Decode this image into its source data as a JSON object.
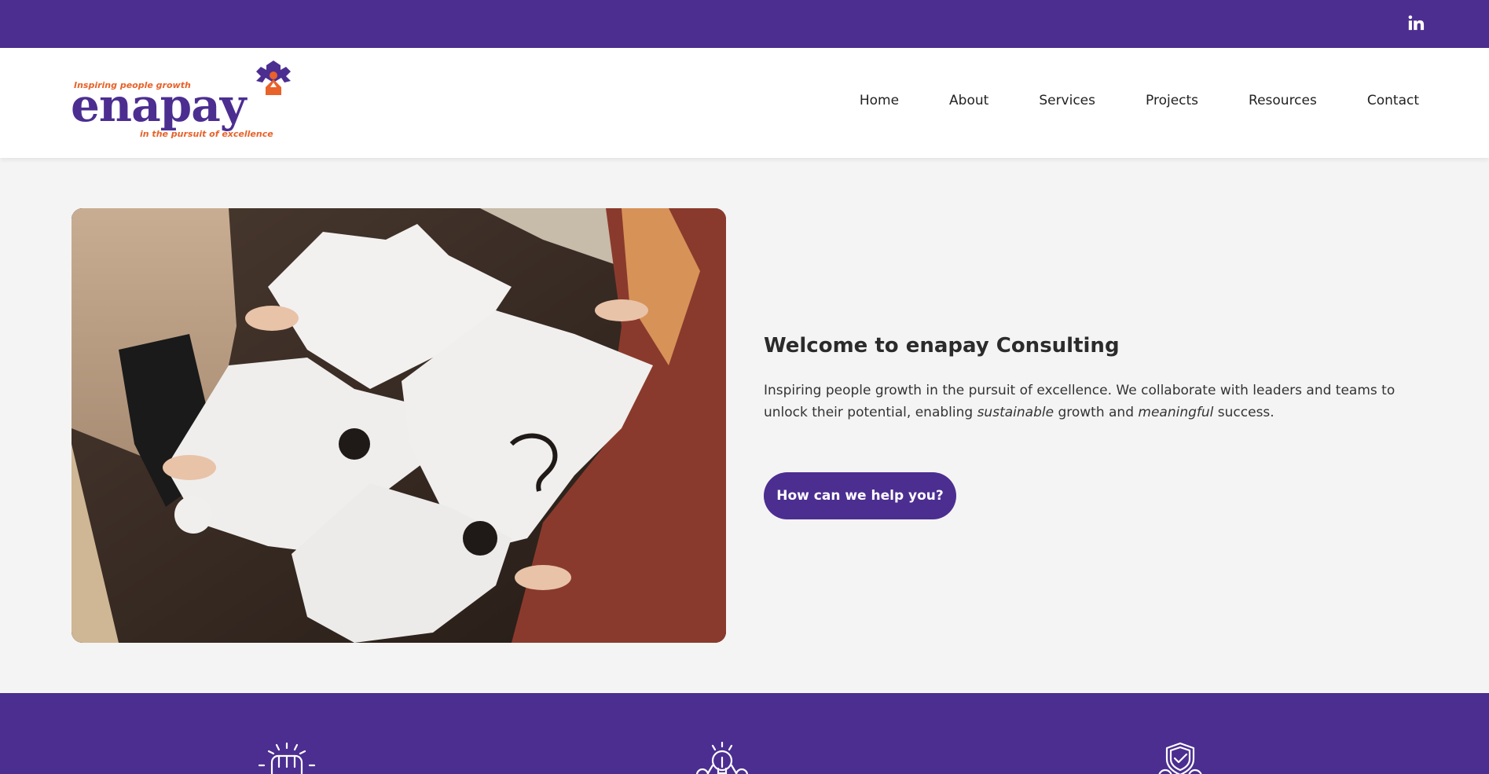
{
  "topbar": {
    "social_icon": "linkedin-icon",
    "bg_color": "#4c2e91"
  },
  "logo": {
    "tagline_top": "Inspiring people growth",
    "wordmark": "enapay",
    "tagline_bottom": "in the pursuit of excellence",
    "brand_color": "#4c2e91",
    "accent_color": "#e8622a"
  },
  "nav": {
    "items": [
      {
        "label": "Home"
      },
      {
        "label": "About"
      },
      {
        "label": "Services"
      },
      {
        "label": "Projects"
      },
      {
        "label": "Resources"
      },
      {
        "label": "Contact"
      }
    ]
  },
  "hero": {
    "image": "puzzle-pieces-team-photo",
    "title": "Welcome to enapay Consulting",
    "desc_part1": "Inspiring people growth in the pursuit of excellence. We collaborate with leaders and teams to unlock their potential, enabling ",
    "desc_em1": "sustainable",
    "desc_part2": " growth and ",
    "desc_em2": "meaningful",
    "desc_part3": " success.",
    "cta_label": "How can we help you?"
  },
  "features": {
    "icons": [
      "fist-bump-icon",
      "lightbulb-icon",
      "shield-check-icon"
    ]
  }
}
